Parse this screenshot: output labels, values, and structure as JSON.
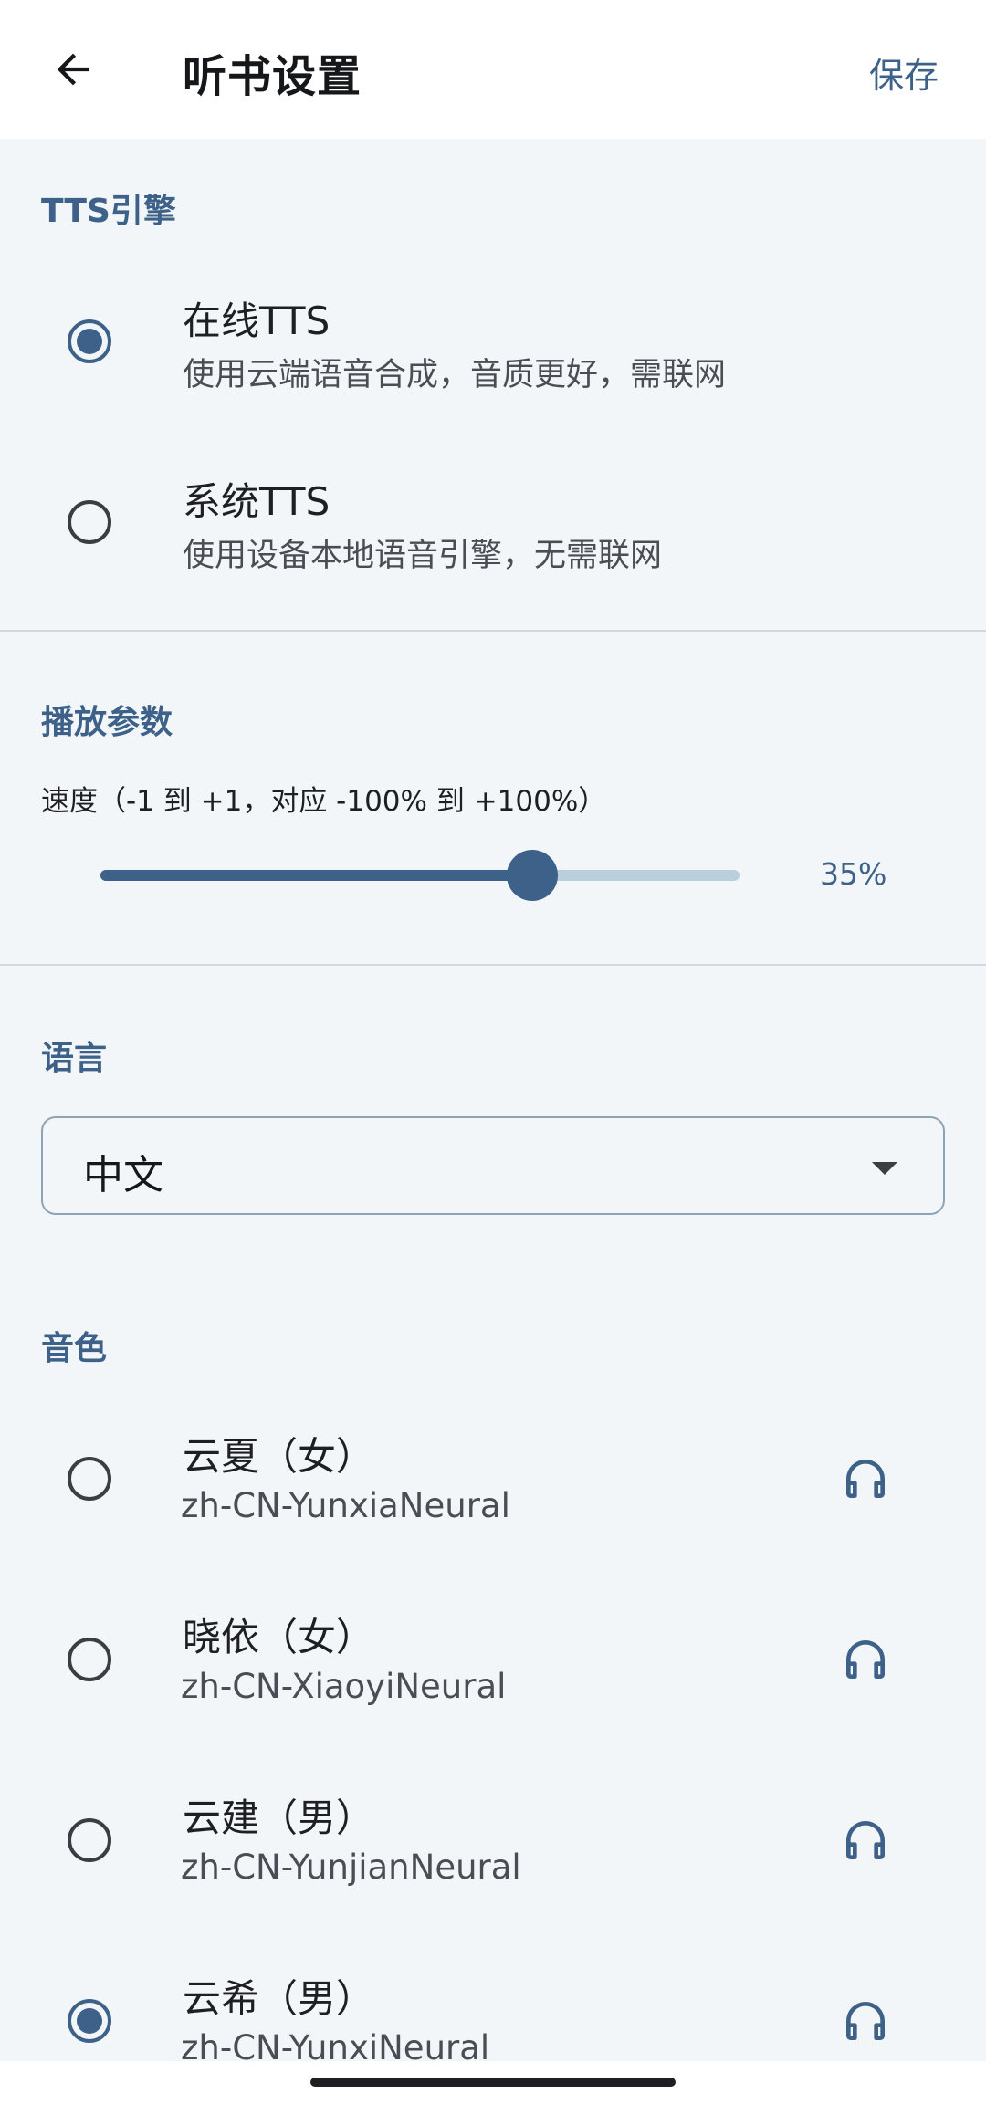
{
  "header": {
    "title": "听书设置",
    "save_label": "保存",
    "back_icon": "arrow-left-icon"
  },
  "tts_engine": {
    "header": "TTS引擎",
    "options": [
      {
        "title": "在线TTS",
        "subtitle": "使用云端语音合成，音质更好，需联网",
        "selected": true
      },
      {
        "title": "系统TTS",
        "subtitle": "使用设备本地语音引擎，无需联网",
        "selected": false
      }
    ]
  },
  "playback": {
    "header": "播放参数",
    "speed_label": "速度（-1 到 +1，对应 -100% 到 +100%）",
    "speed_value": 0.35,
    "speed_display": "35%"
  },
  "language": {
    "header": "语言",
    "selected": "中文"
  },
  "voice": {
    "header": "音色",
    "items": [
      {
        "name": "云夏（女）",
        "code": "zh-CN-YunxiaNeural",
        "selected": false
      },
      {
        "name": "晓依（女）",
        "code": "zh-CN-XiaoyiNeural",
        "selected": false
      },
      {
        "name": "云建（男）",
        "code": "zh-CN-YunjianNeural",
        "selected": false
      },
      {
        "name": "云希（男）",
        "code": "zh-CN-YunxiNeural",
        "selected": true
      }
    ],
    "preview_icon": "headphones-icon"
  },
  "colors": {
    "accent": "#3d6188",
    "background": "#f3f6f9",
    "track_inactive": "#b9cfdc"
  }
}
